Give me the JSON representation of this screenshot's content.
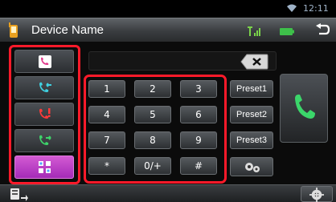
{
  "status": {
    "time": "12:11"
  },
  "header": {
    "title": "Device Name"
  },
  "display": {
    "number": ""
  },
  "keypad": {
    "keys": [
      "1",
      "2",
      "3",
      "4",
      "5",
      "6",
      "7",
      "8",
      "9",
      "*",
      "0/+",
      "#"
    ]
  },
  "presets": [
    "Preset1",
    "Preset2",
    "Preset3"
  ],
  "colors": {
    "accent": "#ff1a2a",
    "active_tab": "#c045c9",
    "call_green": "#3bd66a"
  },
  "sidebar": {
    "items": [
      {
        "icon": "phonebook-icon"
      },
      {
        "icon": "incoming-calls-icon"
      },
      {
        "icon": "missed-calls-icon"
      },
      {
        "icon": "outgoing-calls-icon"
      },
      {
        "icon": "dial-keypad-icon",
        "active": true
      }
    ]
  }
}
